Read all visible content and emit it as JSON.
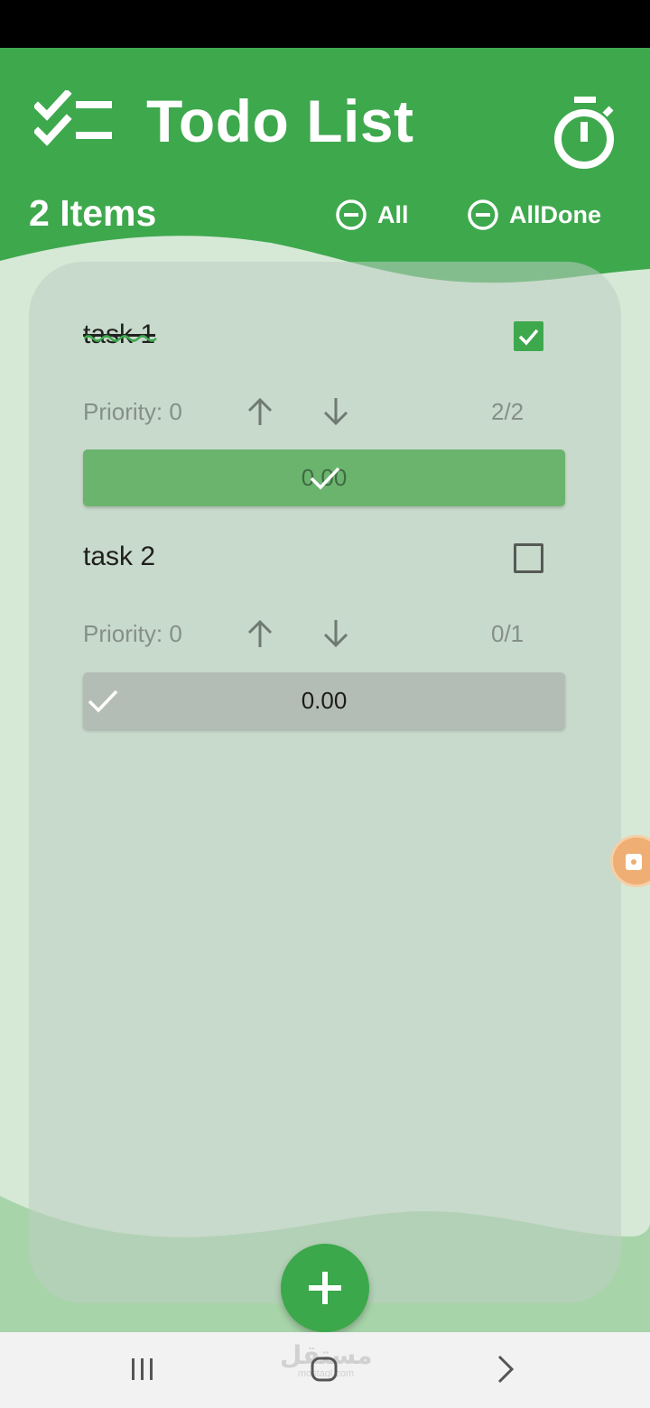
{
  "app": {
    "title": "Todo List",
    "accent_color": "#3ea84d",
    "logo_icon": "checklist-icon",
    "timer_icon": "stopwatch-icon"
  },
  "summary": {
    "items_count": "2 Items",
    "filters": [
      {
        "label": "All",
        "icon": "minus-circle-icon"
      },
      {
        "label": "AllDone",
        "icon": "minus-circle-icon"
      }
    ]
  },
  "tasks": [
    {
      "title": "task 1",
      "completed": true,
      "priority_label": "Priority: 0",
      "count": "2/2",
      "progress_value": "0.00",
      "progress_fraction": 1.0
    },
    {
      "title": "task 2",
      "completed": false,
      "priority_label": "Priority: 0",
      "count": "0/1",
      "progress_value": "0.00",
      "progress_fraction": 0.0
    }
  ],
  "fab": {
    "icon": "plus-icon"
  },
  "watermark": {
    "text": "مستقل",
    "sub": "mostaql.com"
  },
  "nav": {
    "recent_icon": "recent-apps-icon",
    "home_icon": "home-icon",
    "back_icon": "back-icon"
  }
}
